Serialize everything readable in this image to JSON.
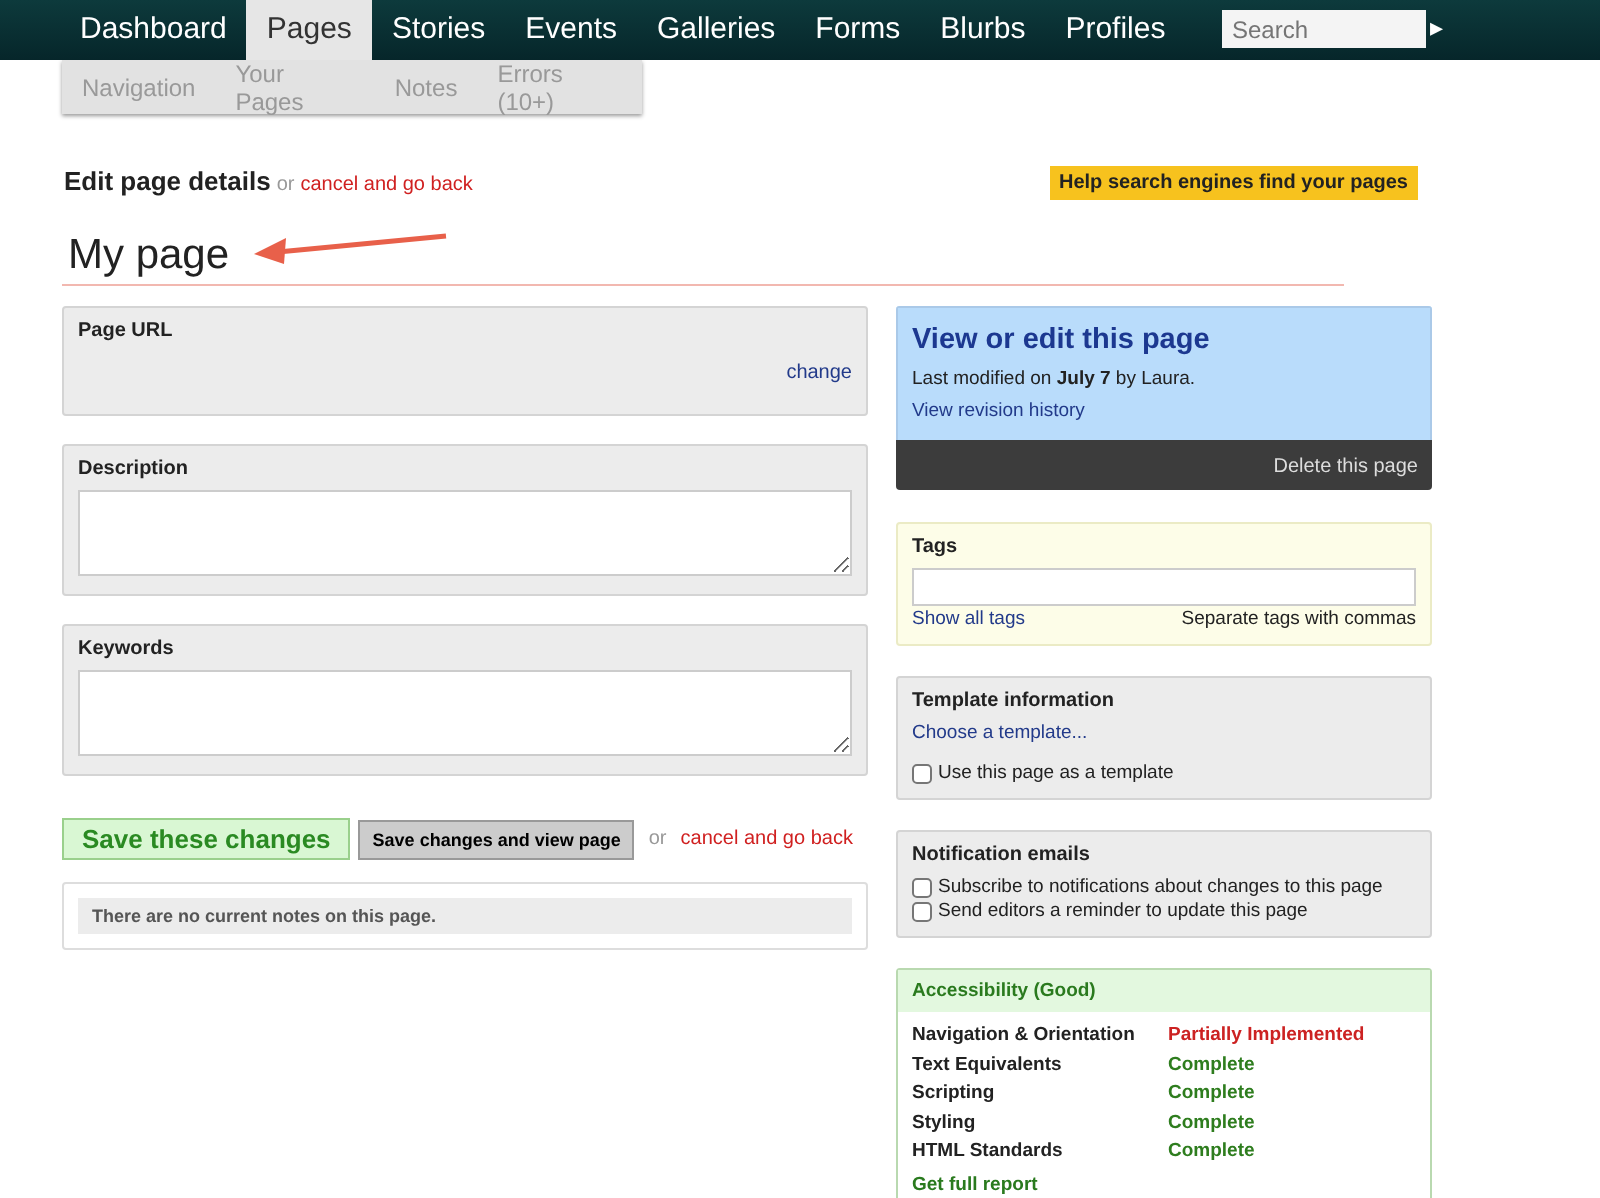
{
  "nav": {
    "tabs": [
      {
        "label": "Dashboard",
        "selected": false
      },
      {
        "label": "Pages",
        "selected": true
      },
      {
        "label": "Stories",
        "selected": false
      },
      {
        "label": "Events",
        "selected": false
      },
      {
        "label": "Galleries",
        "selected": false
      },
      {
        "label": "Forms",
        "selected": false
      },
      {
        "label": "Blurbs",
        "selected": false
      },
      {
        "label": "Profiles",
        "selected": false
      }
    ],
    "search": {
      "placeholder": "Search"
    },
    "go": "▸"
  },
  "subnav": [
    "Navigation",
    "Your Pages",
    "Notes",
    "Errors (10+)"
  ],
  "heading": {
    "title": "Edit page details",
    "or": "or",
    "cancel": "cancel and go back",
    "help": "Help search engines find your pages"
  },
  "page_title": "My page",
  "fields": [
    {
      "kind": "url",
      "label": "Page URL",
      "link": "change"
    },
    {
      "kind": "textarea",
      "label": "Description"
    },
    {
      "kind": "textarea",
      "label": "Keywords"
    }
  ],
  "actions": {
    "save": "Save these changes",
    "save_view": "Save changes and view page",
    "or": "or",
    "cancel": "cancel and go back"
  },
  "notes": "There are no current notes on this page.",
  "view": {
    "title": "View or edit this page",
    "modified": "Last modified on **July 7** by Laura.",
    "history": "View revision history",
    "delete": "Delete this page"
  },
  "tags": {
    "label": "Tags",
    "show_all": "Show all tags",
    "hint": "Separate tags with commas"
  },
  "template": {
    "label": "Template information",
    "choose": "Choose a template...",
    "option": {
      "label": "Use this page as a template",
      "checked": false
    }
  },
  "notifications": {
    "label": "Notification emails",
    "options": [
      {
        "label": "Subscribe to notifications about changes to this page",
        "checked": false
      },
      {
        "label": "Send editors a reminder to update this page",
        "checked": false
      }
    ]
  },
  "accessibility": {
    "title": "Accessibility (Good)",
    "rows": [
      {
        "name": "Navigation & Orientation",
        "status": "Partially Implemented",
        "color": "#cc2222"
      },
      {
        "name": "Text Equivalents",
        "status": "Complete",
        "color": "#2e7d1e"
      },
      {
        "name": "Scripting",
        "status": "Complete",
        "color": "#2e7d1e"
      },
      {
        "name": "Styling",
        "status": "Complete",
        "color": "#2e7d1e"
      },
      {
        "name": "HTML Standards",
        "status": "Complete",
        "color": "#2e7d1e"
      }
    ],
    "report": "Get full report"
  }
}
